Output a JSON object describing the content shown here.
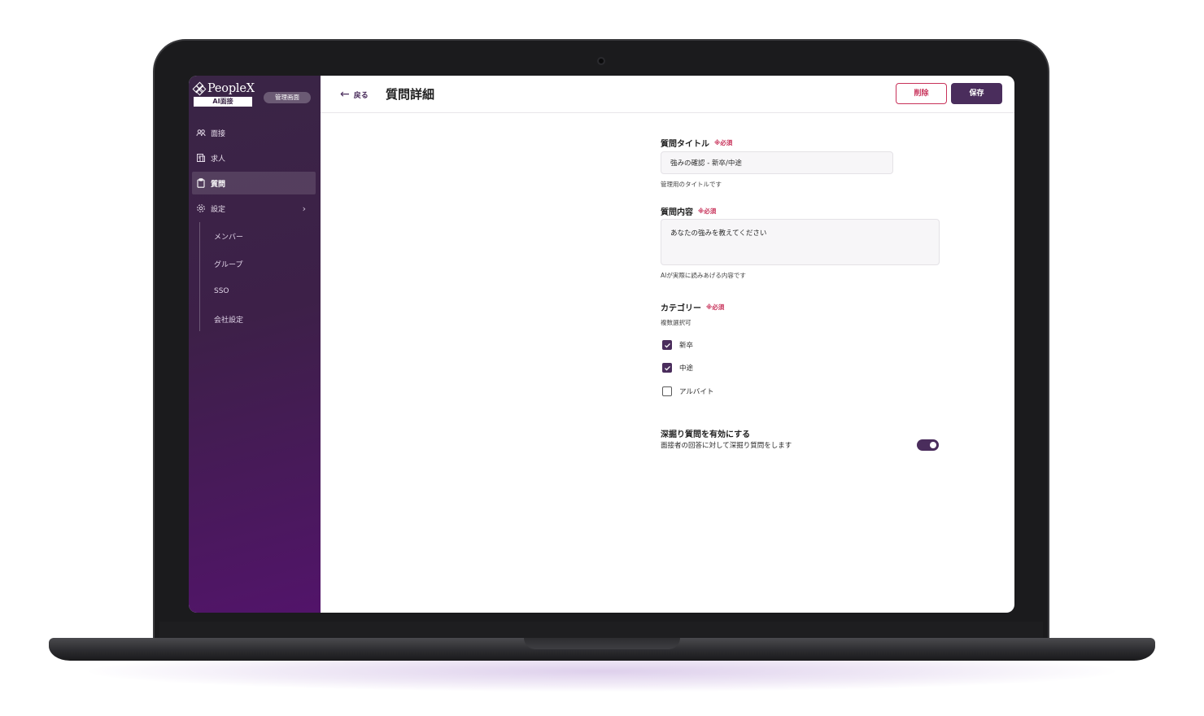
{
  "sidebar": {
    "logo_text": "PeopleX",
    "logo_sub": "AI面接",
    "admin_badge": "管理画面",
    "items": [
      {
        "label": "面接",
        "icon": "people-icon"
      },
      {
        "label": "求人",
        "icon": "document-icon"
      },
      {
        "label": "質問",
        "icon": "clipboard-icon",
        "active": true
      },
      {
        "label": "設定",
        "icon": "gear-icon",
        "chevron": "›"
      }
    ],
    "sub_items": [
      {
        "label": "メンバー"
      },
      {
        "label": "グループ"
      },
      {
        "label": "SSO"
      },
      {
        "label": "会社設定"
      }
    ]
  },
  "header": {
    "back_label": "戻る",
    "title": "質問詳細",
    "delete_label": "削除",
    "save_label": "保存"
  },
  "form": {
    "title_field": {
      "label": "質問タイトル",
      "required": "※必須",
      "value": "強みの確認 - 新卒/中途",
      "help": "管理用のタイトルです"
    },
    "content_field": {
      "label": "質問内容",
      "required": "※必須",
      "value": "あなたの強みを教えてください",
      "help": "AIが実際に読みあげる内容です"
    },
    "category": {
      "label": "カテゴリー",
      "required": "※必須",
      "help": "複数選択可",
      "options": [
        {
          "label": "新卒",
          "checked": true
        },
        {
          "label": "中途",
          "checked": true
        },
        {
          "label": "アルバイト",
          "checked": false
        }
      ]
    },
    "followup": {
      "label": "深掘り質問を有効にする",
      "description": "面接者の回答に対して深掘り質問をします",
      "enabled": true
    }
  },
  "colors": {
    "accent": "#4a2d5c",
    "danger": "#c8325a",
    "sidebar_top": "#3a2546",
    "sidebar_bottom": "#52146a"
  }
}
